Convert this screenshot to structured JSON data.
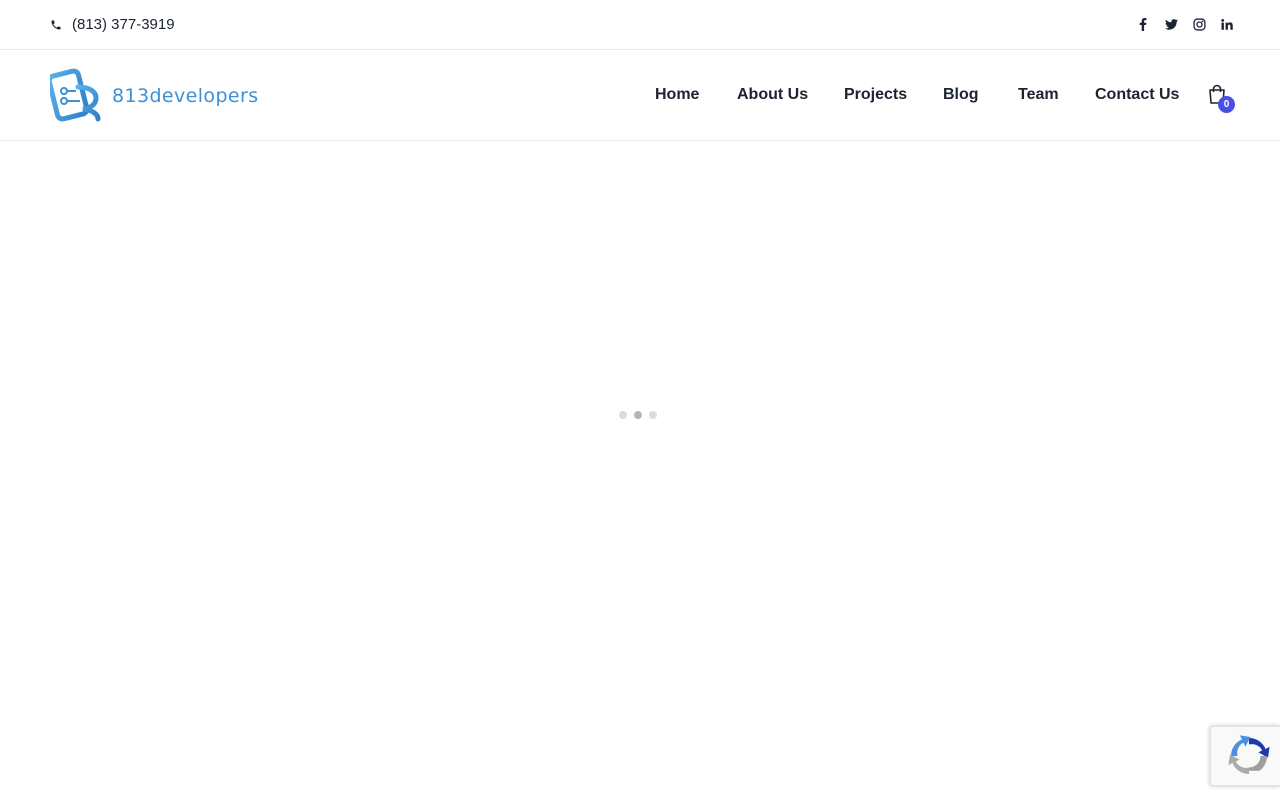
{
  "topbar": {
    "phone": "(813) 377-3919",
    "social": [
      "facebook-icon",
      "twitter-icon",
      "instagram-icon",
      "linkedin-icon"
    ]
  },
  "brand": {
    "name": "813developers",
    "color": "#3d8fd6"
  },
  "nav": {
    "items": [
      {
        "label": "Home"
      },
      {
        "label": "About Us"
      },
      {
        "label": "Projects"
      },
      {
        "label": "Blog"
      },
      {
        "label": "Team"
      },
      {
        "label": "Contact Us"
      }
    ]
  },
  "cart": {
    "count": "0",
    "badge_color": "#4a4fe7"
  },
  "loader": {
    "dots": 3,
    "active_index": 1
  },
  "recaptcha": {
    "icon": "recaptcha-icon"
  }
}
